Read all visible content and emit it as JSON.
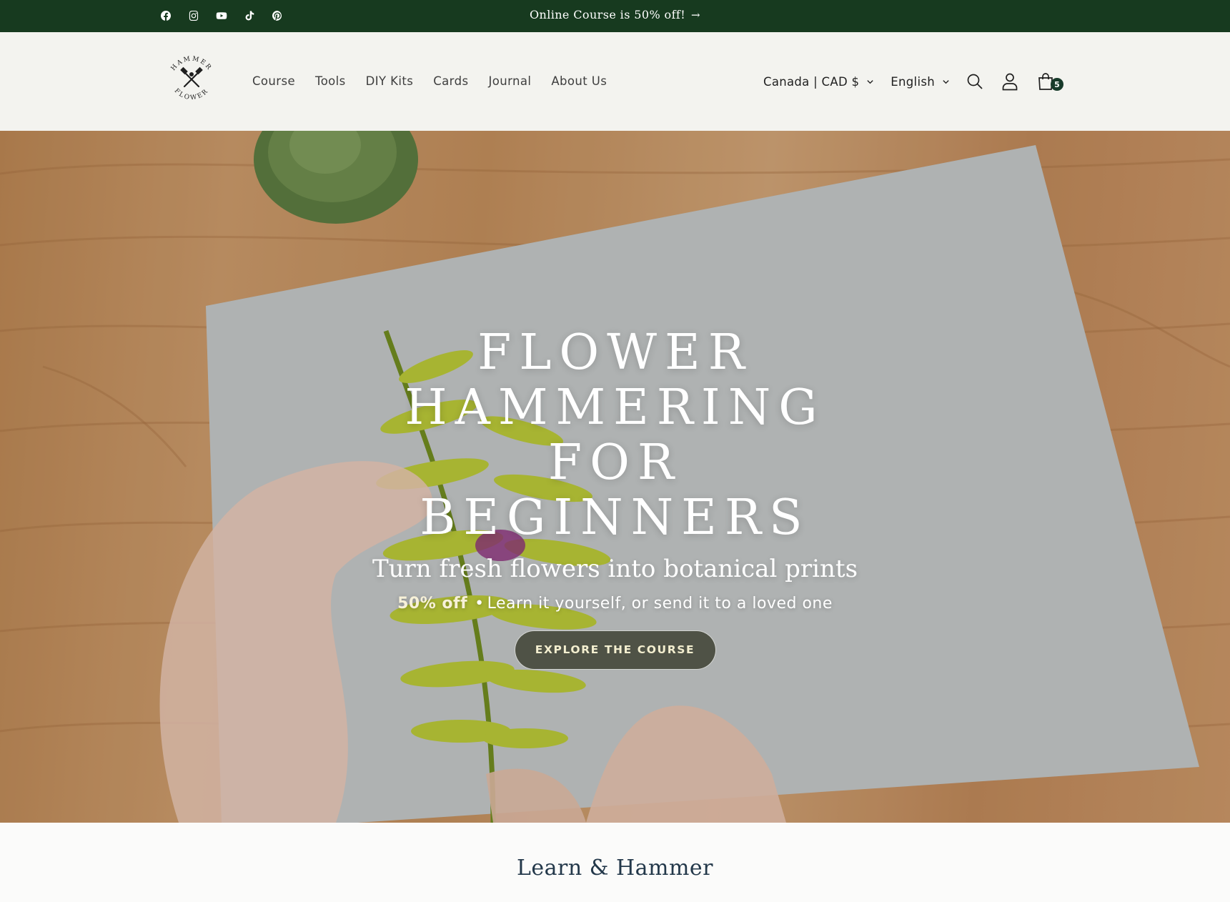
{
  "announcement": {
    "text": "Online Course is 50% off!",
    "arrow_icon": "arrow-right-icon",
    "social_icons": [
      "facebook-icon",
      "instagram-icon",
      "youtube-icon",
      "tiktok-icon",
      "pinterest-icon"
    ]
  },
  "header": {
    "logo": {
      "top_text": "HAMMER",
      "bottom_text": "FLOWER"
    },
    "nav": [
      "Course",
      "Tools",
      "DIY Kits",
      "Cards",
      "Journal",
      "About Us"
    ],
    "country_selector": "Canada | CAD $",
    "language_selector": "English",
    "cart_count": "5"
  },
  "hero": {
    "title": "FLOWER HAMMERING FOR BEGINNERS",
    "subtitle": "Turn fresh flowers into botanical prints",
    "promo": "50% off",
    "separator": "•",
    "tagline": "Learn it yourself, or send it to a loved one",
    "cta_label": "EXPLORE THE COURSE"
  },
  "next_section": {
    "title": "Learn & Hammer"
  },
  "colors": {
    "announcement_bg": "#173a1f",
    "header_bg": "#f3f3ef",
    "cart_badge": "#173a2a",
    "section_title": "#23384a"
  }
}
